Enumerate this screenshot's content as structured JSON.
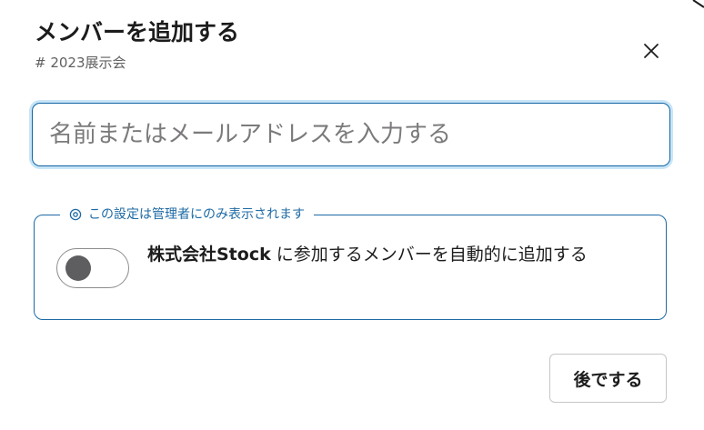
{
  "dialog": {
    "title": "メンバーを追加する",
    "channel": "# 2023展示会",
    "close_icon": "close-icon"
  },
  "search": {
    "placeholder": "名前またはメールアドレスを入力する",
    "value": ""
  },
  "admin_section": {
    "legend_icon": "eye-icon",
    "legend": "この設定は管理者にのみ表示されます",
    "toggle_on": false,
    "org_name": "株式会社Stock",
    "toggle_text": " に参加するメンバーを自動的に追加する"
  },
  "footer": {
    "later_label": "後でする"
  },
  "colors": {
    "accent": "#1264a3",
    "focus_ring": "#c8e5f7",
    "knob": "#5e5d60"
  }
}
